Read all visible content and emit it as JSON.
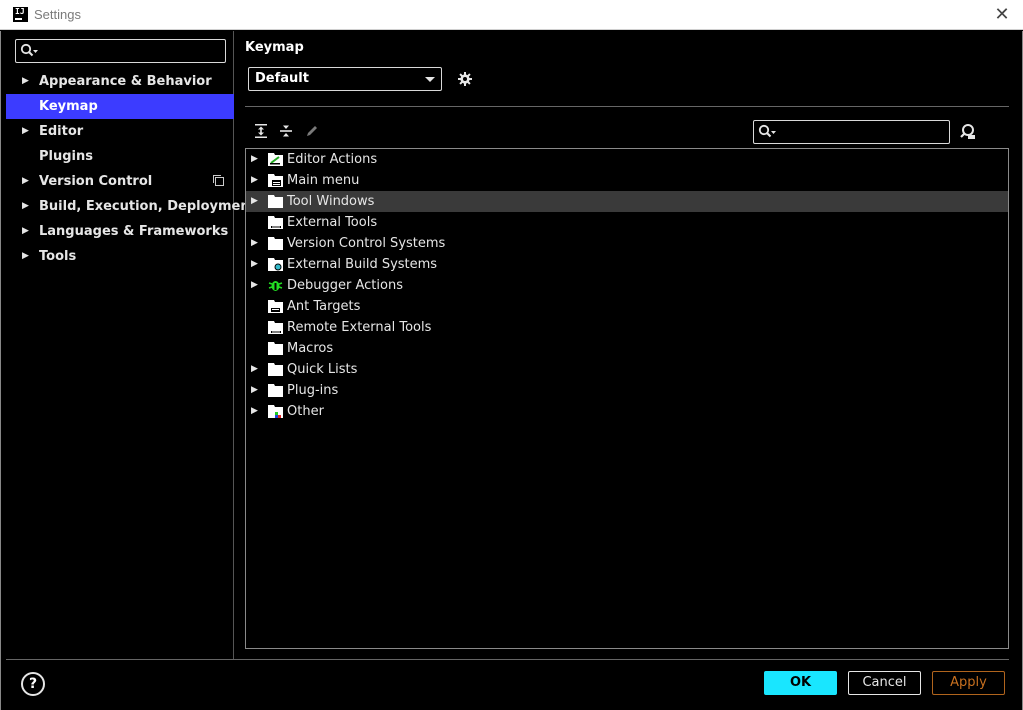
{
  "window": {
    "title": "Settings",
    "logo_text": "IJ"
  },
  "sidebar": {
    "search_placeholder": "",
    "items": [
      {
        "label": "Appearance & Behavior",
        "expandable": true
      },
      {
        "label": "Keymap",
        "expandable": false,
        "selected": true
      },
      {
        "label": "Editor",
        "expandable": true
      },
      {
        "label": "Plugins",
        "expandable": false
      },
      {
        "label": "Version Control",
        "expandable": true,
        "badge_icon": "copy-icon"
      },
      {
        "label": "Build, Execution, Deployment",
        "expandable": true
      },
      {
        "label": "Languages & Frameworks",
        "expandable": true
      },
      {
        "label": "Tools",
        "expandable": true
      }
    ]
  },
  "main": {
    "title": "Keymap",
    "keymap_selected": "Default",
    "toolbar_icons": [
      "expand-all-icon",
      "collapse-all-icon",
      "edit-pencil-icon"
    ],
    "filter_placeholder": "",
    "tree": [
      {
        "label": "Editor Actions",
        "expandable": true,
        "icon": "editor-actions-icon"
      },
      {
        "label": "Main menu",
        "expandable": true,
        "icon": "main-menu-icon"
      },
      {
        "label": "Tool Windows",
        "expandable": true,
        "icon": "folder-icon",
        "highlighted": true
      },
      {
        "label": "External Tools",
        "expandable": false,
        "icon": "external-tools-icon"
      },
      {
        "label": "Version Control Systems",
        "expandable": true,
        "icon": "folder-icon"
      },
      {
        "label": "External Build Systems",
        "expandable": true,
        "icon": "external-build-icon"
      },
      {
        "label": "Debugger Actions",
        "expandable": true,
        "icon": "debugger-bug-icon"
      },
      {
        "label": "Ant Targets",
        "expandable": false,
        "icon": "ant-targets-icon"
      },
      {
        "label": "Remote External Tools",
        "expandable": false,
        "icon": "remote-tools-icon"
      },
      {
        "label": "Macros",
        "expandable": false,
        "icon": "folder-icon"
      },
      {
        "label": "Quick Lists",
        "expandable": true,
        "icon": "folder-icon"
      },
      {
        "label": "Plug-ins",
        "expandable": true,
        "icon": "folder-icon"
      },
      {
        "label": "Other",
        "expandable": true,
        "icon": "other-icon"
      }
    ]
  },
  "footer": {
    "help_label": "?",
    "ok_label": "OK",
    "cancel_label": "Cancel",
    "apply_label": "Apply"
  },
  "colors": {
    "selection": "#3c3cff",
    "ok_button": "#19e6ff",
    "apply_border": "#b0641d",
    "background": "#000000"
  }
}
